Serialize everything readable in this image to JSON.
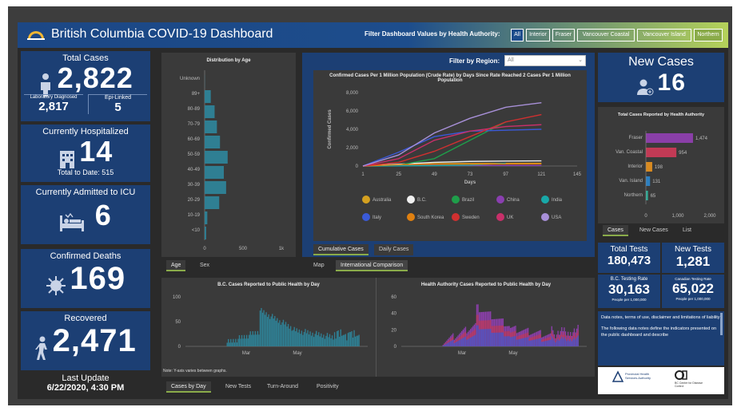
{
  "header": {
    "title": "British Columbia COVID-19 Dashboard",
    "filter_label": "Filter Dashboard Values by Health Authority:",
    "filters": [
      "All",
      "Interior",
      "Fraser",
      "Vancouver Coastal",
      "Vancouver Island",
      "Northern"
    ]
  },
  "total_cases": {
    "title": "Total Cases",
    "value": "2,822",
    "lab_label": "Laboratory Diagnosed",
    "lab_value": "2,817",
    "epi_label": "Epi-Linked",
    "epi_value": "5"
  },
  "hospitalized": {
    "title": "Currently Hospitalized",
    "value": "14",
    "total_label": "Total to Date: 515"
  },
  "icu": {
    "title": "Currently Admitted to ICU",
    "value": "6"
  },
  "deaths": {
    "title": "Confirmed Deaths",
    "value": "169"
  },
  "recovered": {
    "title": "Recovered",
    "value": "2,471"
  },
  "last_update": {
    "label": "Last Update",
    "value": "6/22/2020, 4:30 PM"
  },
  "age_chart": {
    "title": "Distribution by Age",
    "tabs": [
      "Age",
      "Sex"
    ],
    "chart_data": {
      "type": "bar",
      "categories": [
        "Unknown",
        "89+",
        "80-89",
        "70-79",
        "60-69",
        "50-59",
        "40-49",
        "30-39",
        "20-29",
        "10-19",
        "<10"
      ],
      "values": [
        2,
        80,
        130,
        160,
        200,
        300,
        250,
        280,
        190,
        35,
        20
      ],
      "xticks": [
        "0",
        "500",
        "1k"
      ],
      "xlim": [
        0,
        1000
      ]
    }
  },
  "region": {
    "filter_label": "Filter by Region:",
    "filter_value": "All",
    "tabs": [
      "Map",
      "International Comparison"
    ],
    "subtabs": [
      "Cumulative Cases",
      "Daily Cases"
    ]
  },
  "intl_chart": {
    "title": "Confirmed Cases Per 1 Million Population (Crude Rate) by Days Since Rate Reached 2 Cases Per 1 Million Population",
    "ylabel": "Confirmed Cases",
    "xlabel": "Days",
    "chart_data": {
      "type": "line",
      "x": [
        1,
        25,
        49,
        73,
        97,
        121,
        145
      ],
      "ylim": [
        0,
        8000
      ],
      "yticks": [
        "0",
        "2,000",
        "4,000",
        "6,000",
        "8,000"
      ],
      "xticks": [
        "1",
        "25",
        "49",
        "73",
        "97",
        "121",
        "145"
      ],
      "series": [
        {
          "name": "Australia",
          "color": "#d4a020",
          "values": [
            0,
            150,
            250,
            280,
            290,
            300
          ]
        },
        {
          "name": "B.C.",
          "color": "#f0f0f0",
          "values": [
            0,
            200,
            400,
            500,
            540,
            560
          ]
        },
        {
          "name": "Brazil",
          "color": "#1f9e4a",
          "values": [
            0,
            100,
            800,
            2800,
            4800
          ]
        },
        {
          "name": "China",
          "color": "#8a3fb0",
          "values": [
            0,
            50,
            60,
            60,
            60,
            60
          ]
        },
        {
          "name": "India",
          "color": "#18a8a8",
          "values": [
            0,
            20,
            40,
            100,
            300
          ]
        },
        {
          "name": "Italy",
          "color": "#3a5ad8",
          "values": [
            0,
            1500,
            3200,
            3800,
            3900,
            4000
          ]
        },
        {
          "name": "South Korea",
          "color": "#e08010",
          "values": [
            0,
            150,
            200,
            210,
            220,
            230
          ]
        },
        {
          "name": "Sweden",
          "color": "#d03030",
          "values": [
            0,
            400,
            1600,
            3200,
            4800,
            5600
          ]
        },
        {
          "name": "UK",
          "color": "#c8306a",
          "values": [
            0,
            800,
            2800,
            3800,
            4300,
            4500
          ]
        },
        {
          "name": "USA",
          "color": "#a890d8",
          "values": [
            0,
            1200,
            3600,
            5200,
            6400,
            6900
          ]
        }
      ]
    }
  },
  "new_cases": {
    "title": "New Cases",
    "value": "16"
  },
  "ha_chart": {
    "title": "Total Cases Reported by Health Authority",
    "tabs": [
      "Cases",
      "New Cases",
      "List"
    ],
    "chart_data": {
      "type": "bar",
      "categories": [
        "Fraser",
        "Van. Coastal",
        "Interior",
        "Van. Island",
        "Northern"
      ],
      "values": [
        1474,
        954,
        198,
        131,
        65
      ],
      "labels": [
        "1,474",
        "954",
        "198",
        "131",
        "65"
      ],
      "colors": [
        "#8a3fa8",
        "#c23a55",
        "#d88a20",
        "#2d7fc0",
        "#2fae98"
      ],
      "xticks": [
        "0",
        "1,000",
        "2,000"
      ],
      "xlim": [
        0,
        2000
      ]
    }
  },
  "tests": {
    "total_label": "Total Tests",
    "total_value": "180,473",
    "new_label": "New Tests",
    "new_value": "1,281",
    "bc_rate_label": "B.C. Testing Rate",
    "bc_rate_value": "30,163",
    "bc_rate_sub": "People per 1,000,000",
    "can_rate_label": "Canadian Testing Rate",
    "can_rate_value": "65,022",
    "can_rate_sub": "People per 1,000,000"
  },
  "notes": {
    "heading": "Data notes, terms of use, disclaimer and limitations of liability",
    "body": "The following data notes define the indicators presented on the public dashboard and describe"
  },
  "bc_daily": {
    "title": "B.C. Cases Reported to Public Health by Day",
    "chart_data": {
      "type": "bar",
      "yticks": [
        "0",
        "50",
        "100"
      ],
      "ylim": [
        0,
        100
      ],
      "xticks": [
        "Mar",
        "May"
      ]
    }
  },
  "ha_daily": {
    "title": "Health Authority Cases Reported to Public Health by Day",
    "chart_data": {
      "type": "bar",
      "yticks": [
        "0",
        "20",
        "40",
        "60"
      ],
      "ylim": [
        0,
        60
      ],
      "xticks": [
        "Mar",
        "May"
      ]
    }
  },
  "bottom": {
    "note": "Note: Y-axis varies between graphs.",
    "tabs": [
      "Cases by Day",
      "New Tests",
      "Turn-Around",
      "Positivity"
    ]
  },
  "logos": {
    "phsa": "Provincial Health Services Authority",
    "bccdc": "BC Centre for Disease Control"
  }
}
